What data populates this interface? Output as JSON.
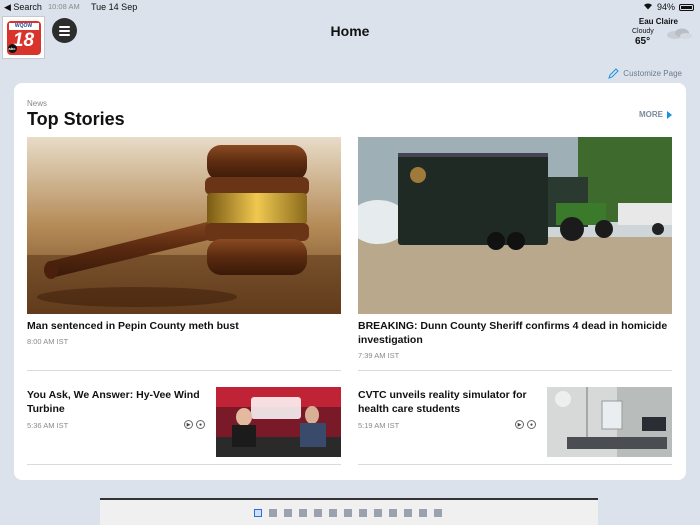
{
  "status_bar": {
    "back_label": "◀ Search",
    "time": "10:08 AM",
    "date": "Tue 14 Sep",
    "battery": "94%"
  },
  "header": {
    "title": "Home",
    "logo_call": "WQOW",
    "logo_number": "18",
    "logo_network": "abc"
  },
  "weather": {
    "city": "Eau Claire",
    "condition": "Cloudy",
    "temperature": "65°"
  },
  "customize_label": "Customize Page",
  "section": {
    "label": "News",
    "title": "Top Stories",
    "more_label": "MORE"
  },
  "stories": [
    {
      "headline": "Man sentenced in Pepin County meth bust",
      "time": "8:00 AM IST"
    },
    {
      "headline": "BREAKING: Dunn County Sheriff confirms 4 dead in homicide investigation",
      "time": "7:39 AM IST"
    },
    {
      "headline": "You Ask, We Answer: Hy-Vee Wind Turbine",
      "time": "5:36 AM IST"
    },
    {
      "headline": "CVTC unveils reality simulator for health care students",
      "time": "5:19 AM IST"
    }
  ],
  "pages": {
    "count": 13,
    "active": 1
  },
  "colors": {
    "accent": "#1d8fe0",
    "background": "#dbe2ec",
    "brand_red": "#d9342b"
  }
}
